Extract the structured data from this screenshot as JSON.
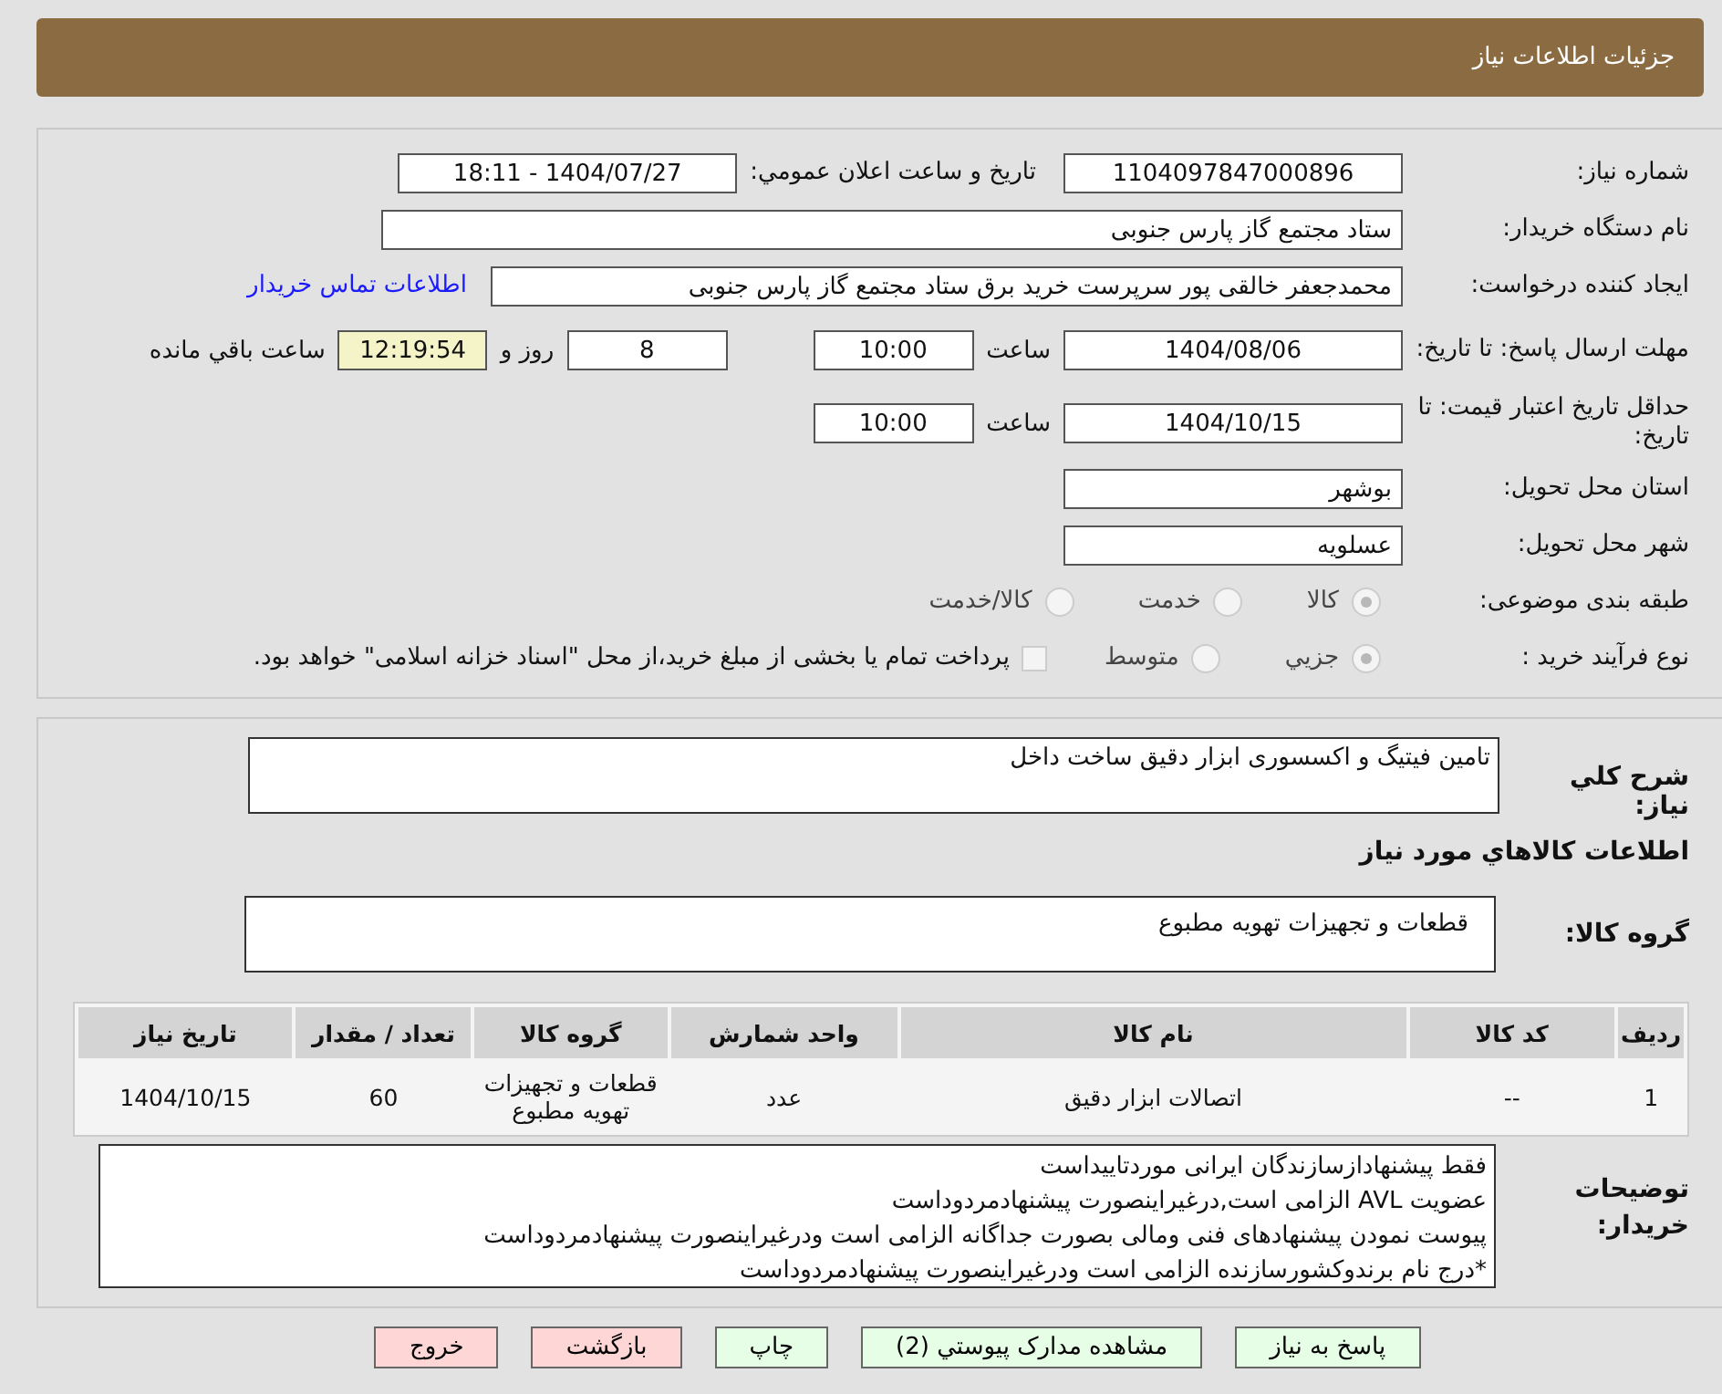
{
  "header": {
    "title": "جزئیات اطلاعات نیاز"
  },
  "need_number": {
    "label": "شماره نیاز:",
    "value": "1104097847000896"
  },
  "announce": {
    "label": "تاریخ و ساعت اعلان عمومي:",
    "value": "1404/07/27 - 18:11"
  },
  "buyer_org": {
    "label": "نام دستگاه خریدار:",
    "value": "ستاد مجتمع گاز پارس جنوبی"
  },
  "requester": {
    "label": "ایجاد کننده درخواست:",
    "value": "محمدجعفر خالقی پور سرپرست خرید برق ستاد مجتمع گاز پارس جنوبی",
    "link": "اطلاعات تماس خریدار"
  },
  "deadline": {
    "label": "مهلت ارسال پاسخ: تا تاریخ:",
    "date": "1404/08/06",
    "time_label": "ساعت",
    "time": "10:00",
    "days": "8",
    "days_suffix": "روز و",
    "countdown": "12:19:54",
    "countdown_suffix": "ساعت باقي مانده"
  },
  "validity": {
    "label": "حداقل تاریخ اعتبار قیمت: تا تاریخ:",
    "date": "1404/10/15",
    "time_label": "ساعت",
    "time": "10:00"
  },
  "province": {
    "label": "استان محل تحویل:",
    "value": "بوشهر"
  },
  "city": {
    "label": "شهر محل تحویل:",
    "value": "عسلویه"
  },
  "category": {
    "label": "طبقه بندی موضوعی:",
    "options": [
      {
        "label": "کالا",
        "selected": true
      },
      {
        "label": "خدمت",
        "selected": false
      },
      {
        "label": "کالا/خدمت",
        "selected": false
      }
    ]
  },
  "process": {
    "label": "نوع فرآیند خرید :",
    "options": [
      {
        "label": "جزيي",
        "selected": true
      },
      {
        "label": "متوسط",
        "selected": false
      }
    ],
    "checkbox": {
      "label": "پرداخت تمام یا بخشی از مبلغ خرید،از محل \"اسناد خزانه اسلامی\" خواهد بود.",
      "checked": false
    }
  },
  "description": {
    "label": "شرح کلي نیاز:",
    "value": "تامین فیتیگ و اکسسوری ابزار دقیق ساخت داخل"
  },
  "goods_title": "اطلاعات کالاهاي مورد نیاز",
  "goods_group": {
    "label": "گروه کالا:",
    "value": "قطعات و تجهیزات تهویه مطبوع"
  },
  "table": {
    "columns": [
      "ردیف",
      "کد کالا",
      "نام کالا",
      "واحد شمارش",
      "گروه کالا",
      "تعداد / مقدار",
      "تاریخ نیاز"
    ],
    "rows": [
      [
        "1",
        "--",
        "اتصالات ابزار دقیق",
        "عدد",
        "قطعات و تجهیزات تهویه مطبوع",
        "60",
        "1404/10/15"
      ]
    ]
  },
  "buyer_notes": {
    "label": "توضیحات خریدار:",
    "lines": [
      "فقط پیشنهادازسازندگان ایرانی موردتاییداست",
      "عضویت AVL الزامی است,درغیراینصورت پیشنهادمردوداست",
      "پیوست نمودن پیشنهادهای فنی ومالی بصورت جداگانه الزامی است ودرغیراینصورت پیشنهادمردوداست",
      "*درج نام برندوکشورسازنده الزامی است ودرغیراینصورت پیشنهادمردوداست"
    ]
  },
  "buttons": [
    {
      "label": "پاسخ به نیاز",
      "kind": "primary"
    },
    {
      "label": "مشاهده مدارک پیوستي (2)",
      "kind": "primary"
    },
    {
      "label": "چاپ",
      "kind": "primary"
    },
    {
      "label": "بازگشت",
      "kind": "danger"
    },
    {
      "label": "خروج",
      "kind": "danger"
    }
  ]
}
